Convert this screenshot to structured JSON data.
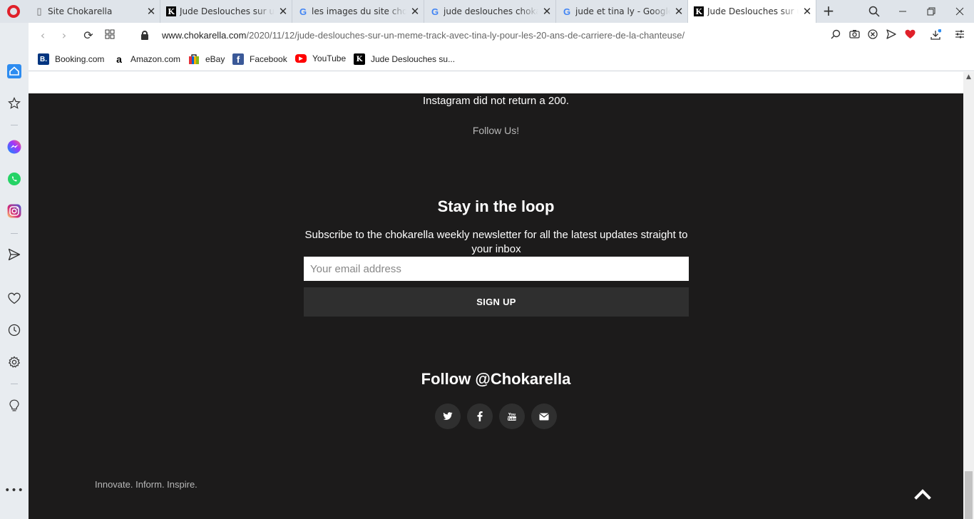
{
  "tabs": [
    {
      "title": "Site Chokarella",
      "favicon": "doc-icon"
    },
    {
      "title": "Jude Deslouches sur un mê",
      "favicon": "k-icon"
    },
    {
      "title": "les images du site chokarella",
      "favicon": "google-icon"
    },
    {
      "title": "jude deslouches chokatrella",
      "favicon": "google-icon"
    },
    {
      "title": "jude et tina ly - Google S",
      "favicon": "google-icon"
    },
    {
      "title": "Jude Deslouches sur un mê",
      "favicon": "k-icon",
      "active": true
    }
  ],
  "address": {
    "host": "www.chokarella.com",
    "path": "/2020/11/12/jude-deslouches-sur-un-meme-track-avec-tina-ly-pour-les-20-ans-de-carriere-de-la-chanteuse/"
  },
  "bookmarks": [
    {
      "label": "Booking.com",
      "icon": "booking-icon",
      "color": "#003580",
      "glyph": "B."
    },
    {
      "label": "Amazon.com",
      "icon": "amazon-icon",
      "color": "#ffffff",
      "glyph": "a"
    },
    {
      "label": "eBay",
      "icon": "ebay-icon",
      "color": "#e53238",
      "glyph": "e"
    },
    {
      "label": "Facebook",
      "icon": "facebook-icon",
      "color": "#3b5998",
      "glyph": "f"
    },
    {
      "label": "YouTube",
      "icon": "youtube-icon",
      "color": "#ff0000",
      "glyph": "▶"
    },
    {
      "label": "Jude Deslouches su...",
      "icon": "k-icon",
      "color": "#000000",
      "glyph": "K"
    }
  ],
  "footer": {
    "instagram_message": "Instagram did not return a 200.",
    "follow_us": "Follow Us!",
    "loop_title": "Stay in the loop",
    "loop_subtitle": "Subscribe to the chokarella weekly newsletter for all the latest updates straight to your inbox",
    "email_placeholder": "Your email address",
    "signup_label": "SIGN UP",
    "follow_handle": "Follow @Chokarella",
    "tagline": "Innovate. Inform. Inspire."
  },
  "social": [
    {
      "name": "twitter-icon",
      "glyph": "t"
    },
    {
      "name": "facebook-icon",
      "glyph": "f"
    },
    {
      "name": "youtube-icon",
      "glyph": "▶"
    },
    {
      "name": "envelope-icon",
      "glyph": "✉"
    }
  ],
  "colors": {
    "footer_bg": "#1c1b1b",
    "button_bg": "#2f2f2f",
    "opera_red": "#e0202a",
    "sidebar_bg": "#e8ecf0"
  }
}
